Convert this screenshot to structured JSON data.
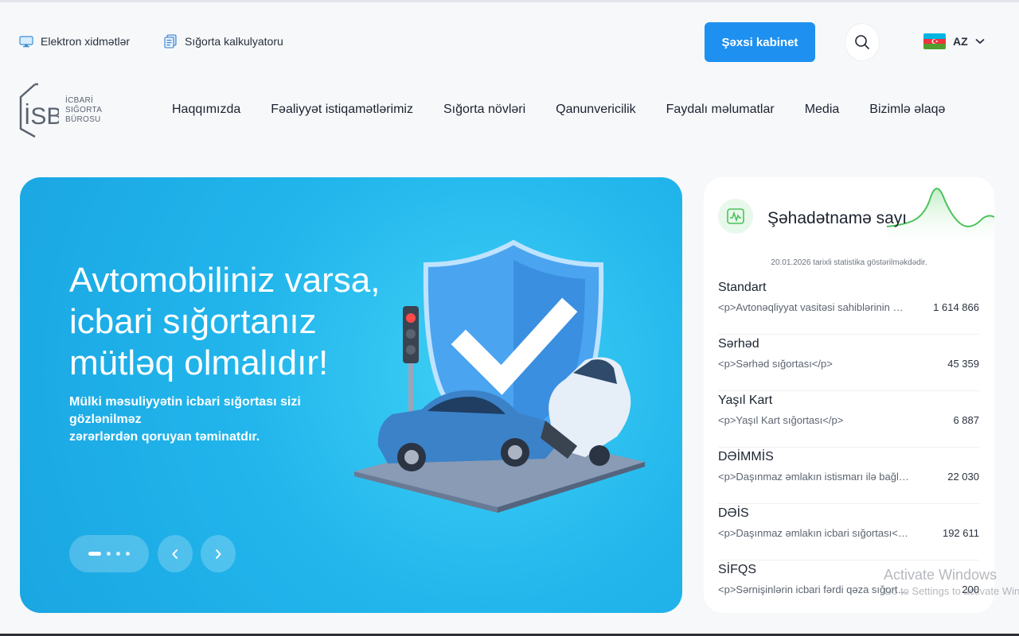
{
  "utility": {
    "electronic_services": "Elektron xidmətlər",
    "calculator": "Sığorta kalkulyatoru"
  },
  "header": {
    "cabinet_button": "Şəxsi kabinet",
    "language": "AZ"
  },
  "logo": {
    "mark": "İSB",
    "line1": "İCBARİ",
    "line2": "SIĞORTA",
    "line3": "BÜROSU"
  },
  "nav": {
    "items": [
      {
        "label": "Haqqımızda"
      },
      {
        "label": "Fəaliyyət istiqamətlərimiz"
      },
      {
        "label": "Sığorta növləri"
      },
      {
        "label": "Qanunvericilik"
      },
      {
        "label": "Faydalı məlumatlar"
      },
      {
        "label": "Media"
      },
      {
        "label": "Bizimlə əlaqə"
      }
    ]
  },
  "hero": {
    "title_lines": [
      "Avtomobiliniz varsa,",
      "icbari sığortanız",
      "mütləq olmalıdır!"
    ],
    "subtitle_lines": [
      "Mülki məsuliyyətin icbari sığortası sizi",
      "gözlənilməz",
      "zərərlərdən qoruyan təminatdır."
    ],
    "slides_total": 4,
    "active_slide": 1,
    "prev_icon": "chevron-left-icon",
    "next_icon": "chevron-right-icon"
  },
  "stats": {
    "title": "Şəhadətnamə sayı",
    "note": "20.01.2026 tarixli statistika göstərilməkdədir.",
    "rows": [
      {
        "name": "Standart",
        "desc": "<p>Avtonəqliyyat vasitəsi sahiblərinin mülki məsuliyyətinin icbari sığortası</p>",
        "value": "1 614 866"
      },
      {
        "name": "Sərhəd",
        "desc": "<p>Sərhəd sığortası</p>",
        "value": "45 359"
      },
      {
        "name": "Yaşıl Kart",
        "desc": "<p>Yaşıl Kart sığortası</p>",
        "value": "6 887"
      },
      {
        "name": "DƏİMMİS",
        "desc": "<p>Daşınmaz əmlakın istismarı ilə bağlı mülki məsuliyyətin icbari sığortası</p>",
        "value": "22 030"
      },
      {
        "name": "DƏİS",
        "desc": "<p>Daşınmaz əmlakın icbari sığortası</p>",
        "value": "192 611"
      },
      {
        "name": "SİFQS",
        "desc": "<p>Sərnişinlərin icbari fərdi qəza sığortası</p>",
        "value": "200"
      }
    ]
  },
  "watermark": {
    "line1": "Activate Windows",
    "line2": "Go to Settings to activate Windows."
  },
  "colors": {
    "accent": "#1e90f0",
    "hero_bg": "#22b6ec",
    "chart_green": "#4cc35a"
  }
}
